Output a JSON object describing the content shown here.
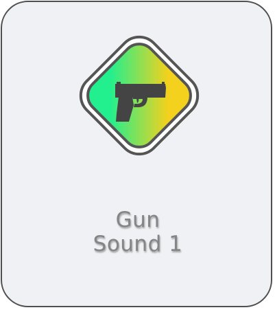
{
  "card": {
    "title_line1": "Gun",
    "title_line2": "Sound 1",
    "icon": "pistol-icon"
  },
  "colors": {
    "card_background": "#f0f1f4",
    "border": "#4f4f4f",
    "title_text": "#858585",
    "gradient_start": "#22ef8e",
    "gradient_end": "#f4d11c",
    "icon_fill": "#444444"
  }
}
